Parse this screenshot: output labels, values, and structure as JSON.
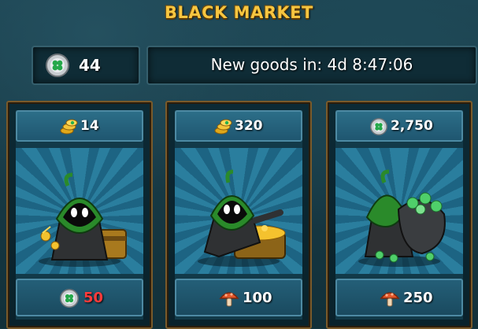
{
  "header": {
    "title": "BLACK MARKET"
  },
  "currency": {
    "icon": "clover-coin-icon",
    "amount": "44"
  },
  "timer": {
    "text": "New goods in: 4d 8:47:06"
  },
  "colors": {
    "title": "#f7c640",
    "price_insufficient": "#ff3b3b",
    "background": "#163743"
  },
  "cards": [
    {
      "item_icon": "hooded-thief-with-gold-icon",
      "top_price": {
        "icon": "gold-coins-icon",
        "value": "14"
      },
      "cost": {
        "icon": "clover-coin-icon",
        "value": "50",
        "insufficient": true
      }
    },
    {
      "item_icon": "hooded-thief-with-treasure-chest-icon",
      "top_price": {
        "icon": "gold-coins-icon",
        "value": "320"
      },
      "cost": {
        "icon": "mushroom-icon",
        "value": "100",
        "insufficient": false
      }
    },
    {
      "item_icon": "hooded-thief-with-clover-sack-icon",
      "top_price": {
        "icon": "clover-coin-icon",
        "value": "2,750"
      },
      "cost": {
        "icon": "mushroom-icon",
        "value": "250",
        "insufficient": false
      }
    }
  ]
}
